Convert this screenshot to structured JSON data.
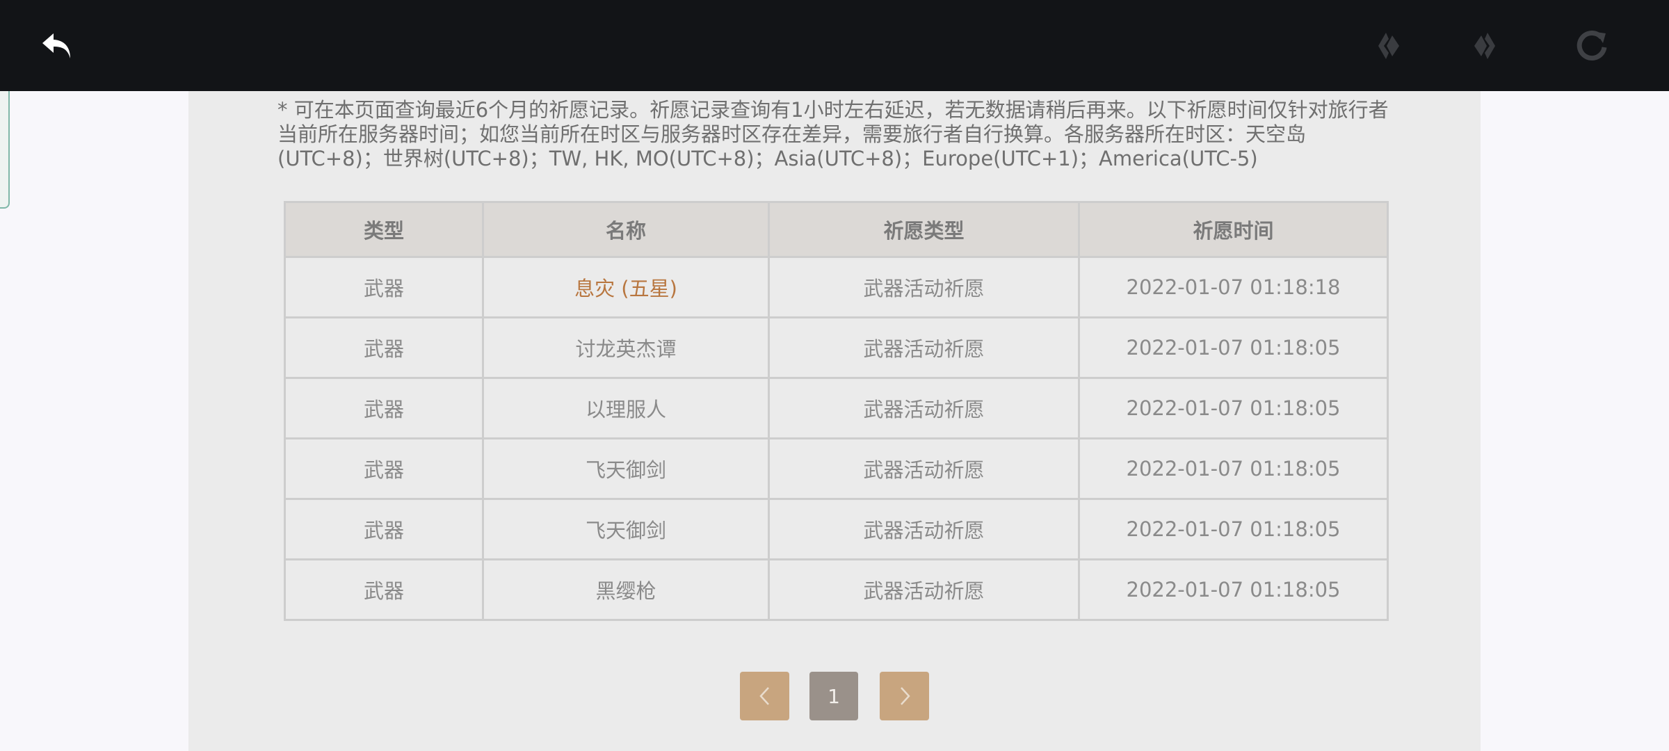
{
  "topbar": {
    "icons": [
      "back-icon",
      "prev-nav-icon",
      "next-nav-icon",
      "reload-icon"
    ]
  },
  "notice": "* 可在本页面查询最近6个月的祈愿记录。祈愿记录查询有1小时左右延迟，若无数据请稍后再来。以下祈愿时间仅针对旅行者当前所在服务器时间；如您当前所在时区与服务器时区存在差异，需要旅行者自行换算。各服务器所在时区：天空岛(UTC+8)；世界树(UTC+8)；TW, HK, MO(UTC+8)；Asia(UTC+8)；Europe(UTC+1)；America(UTC-5)",
  "table": {
    "headers": [
      "类型",
      "名称",
      "祈愿类型",
      "祈愿时间"
    ],
    "rows": [
      [
        "武器",
        "息灾 (五星)",
        "武器活动祈愿",
        "2022-01-07 01:18:18"
      ],
      [
        "武器",
        "讨龙英杰谭",
        "武器活动祈愿",
        "2022-01-07 01:18:05"
      ],
      [
        "武器",
        "以理服人",
        "武器活动祈愿",
        "2022-01-07 01:18:05"
      ],
      [
        "武器",
        "飞天御剑",
        "武器活动祈愿",
        "2022-01-07 01:18:05"
      ],
      [
        "武器",
        "飞天御剑",
        "武器活动祈愿",
        "2022-01-07 01:18:05"
      ],
      [
        "武器",
        "黑缨枪",
        "武器活动祈愿",
        "2022-01-07 01:18:05"
      ]
    ]
  },
  "pagination": {
    "current_page": "1",
    "prev_icon": "chevron-left-icon",
    "next_icon": "chevron-right-icon"
  },
  "colors": {
    "topbar": "#121417",
    "five_star_text": "#b8763f",
    "pager_accent": "#c8a57f",
    "pager_current": "#9a918a"
  }
}
